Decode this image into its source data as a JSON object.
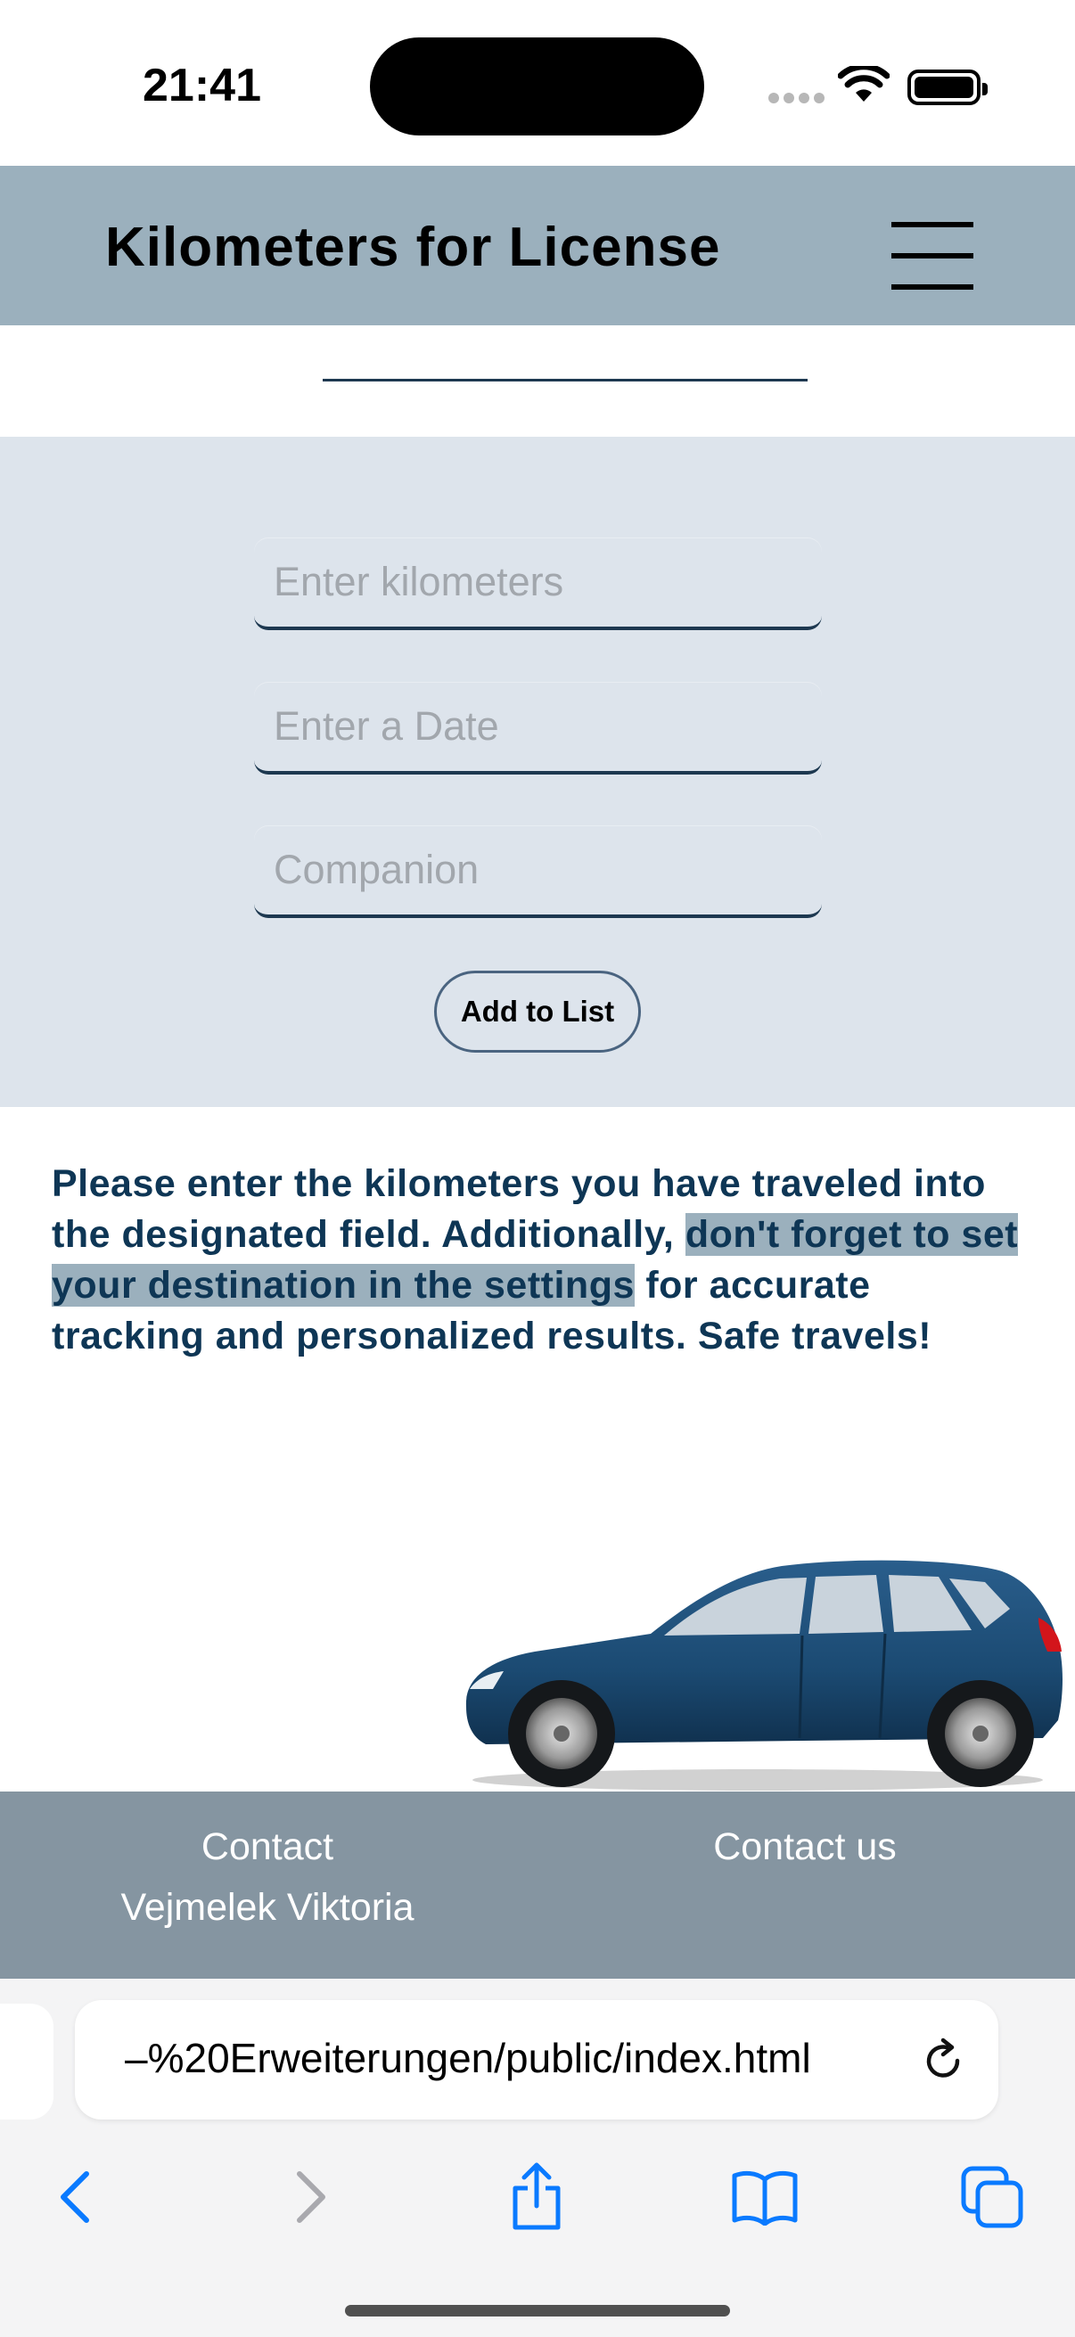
{
  "status_bar": {
    "time": "21:41"
  },
  "header": {
    "title": "Kilometers for License"
  },
  "form": {
    "km_placeholder": "Enter kilometers",
    "date_placeholder": "Enter a Date",
    "companion_placeholder": "Companion",
    "add_label": "Add to List"
  },
  "info": {
    "part1": "Please enter the kilometers you have traveled into the designated field. Additionally, ",
    "highlight": "don't forget to set your destination in the settings",
    "part2": " for accurate tracking and personalized results. Safe travels!"
  },
  "footer": {
    "contact_heading": "Contact",
    "contact_name": "Vejmelek Viktoria",
    "contact_us": "Contact us"
  },
  "browser": {
    "url": "–%20Erweiterungen/public/index.html"
  },
  "colors": {
    "header_bg": "#9bb0bd",
    "form_bg": "#dde4ec",
    "text_navy": "#0e3655",
    "footer_bg": "#8595a1",
    "car_blue": "#1b4a72",
    "ios_blue": "#0a7aff"
  },
  "icons": [
    "wifi-icon",
    "battery-icon",
    "hamburger-menu-icon",
    "reload-icon",
    "back-icon",
    "forward-icon",
    "share-icon",
    "bookmarks-icon",
    "tabs-icon"
  ]
}
